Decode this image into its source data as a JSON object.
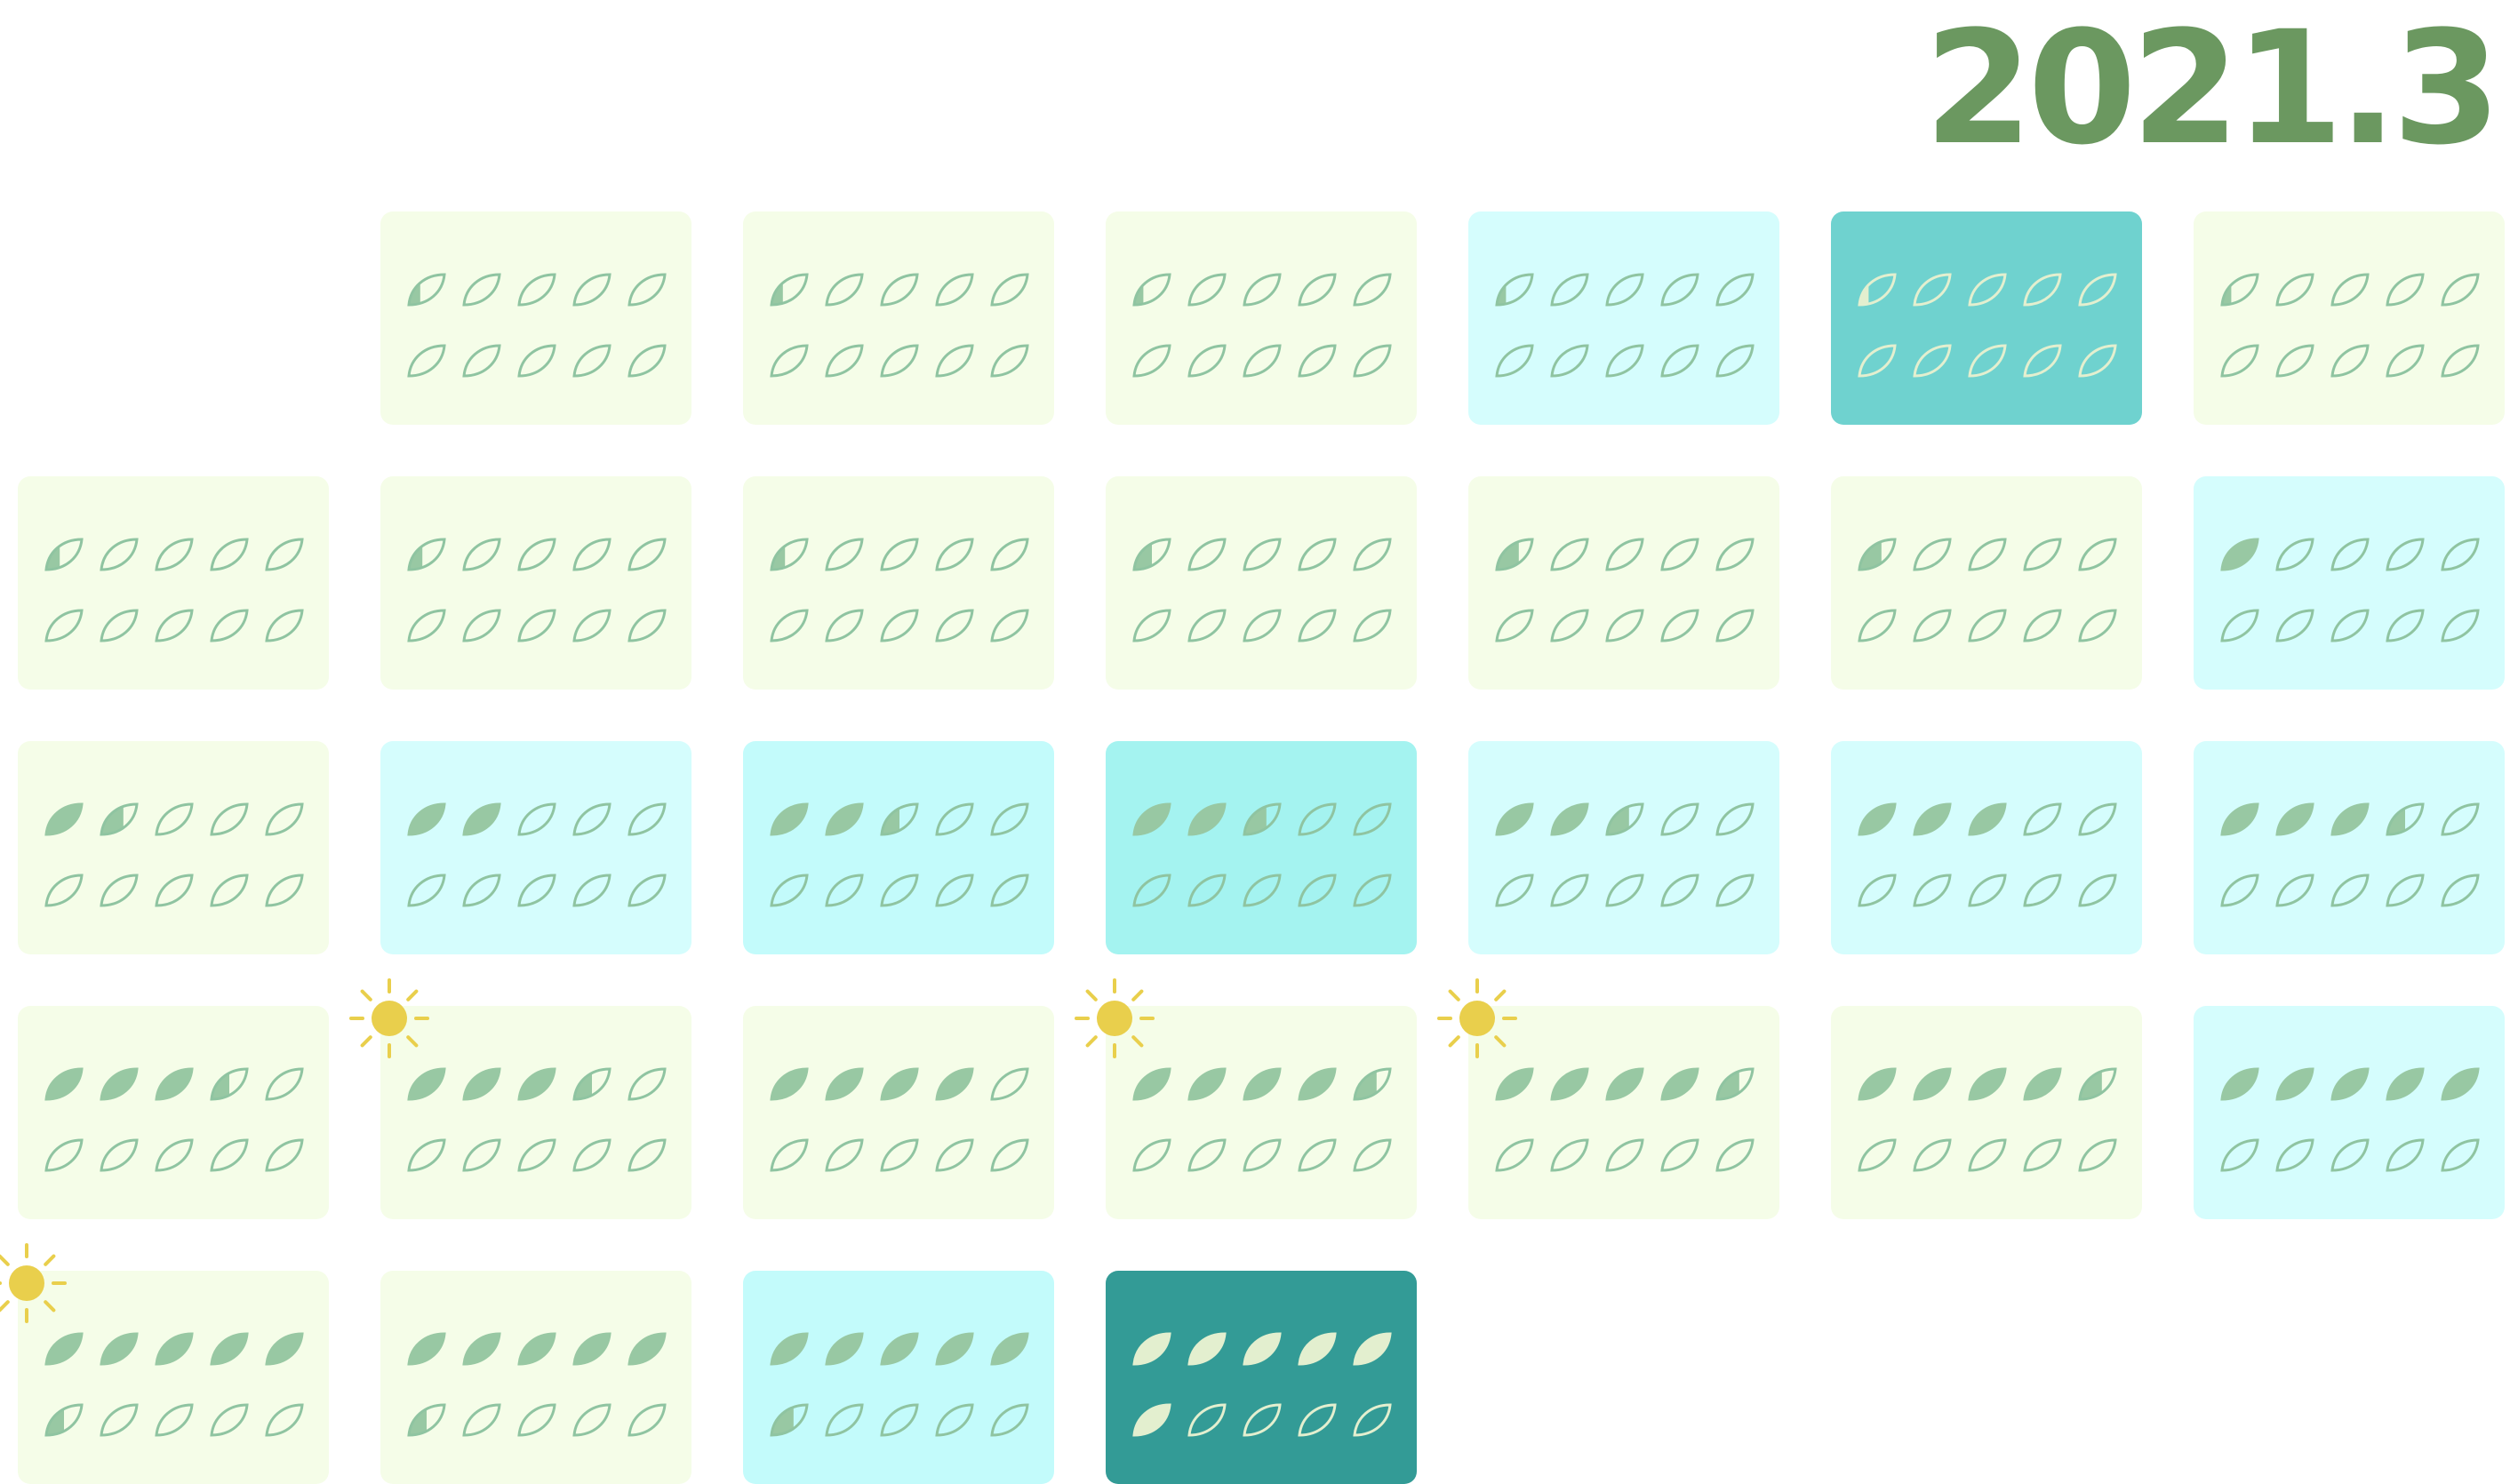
{
  "header": {
    "title": "2021.3"
  },
  "leaf_slots_per_day": 10,
  "colors": {
    "leaf_fill": "#98c8a3",
    "leaf_outline": "#8fc4a1",
    "leaf_fill_on_dark": "#e3efcf",
    "leaf_outline_on_dark": "#e3efcf",
    "sun": "#e9cf4c",
    "title": "#6b9860",
    "background": {
      "pale_green": "#f5fde8",
      "pale_cyan": "#d5fdfd",
      "light_cyan": "#c3fbfb",
      "cyan": "#a4f3f0",
      "teal": "#6fd2cf",
      "dark_teal": "#339b96"
    }
  },
  "days": [
    {
      "level": 0.35,
      "bg": "pale_green",
      "sun": false
    },
    {
      "level": 0.35,
      "bg": "pale_green",
      "sun": false
    },
    {
      "level": 0.3,
      "bg": "pale_green",
      "sun": false
    },
    {
      "level": 0.3,
      "bg": "pale_cyan",
      "sun": false
    },
    {
      "level": 0.3,
      "bg": "teal",
      "sun": false
    },
    {
      "level": 0.3,
      "bg": "pale_green",
      "sun": false
    },
    {
      "level": 0.4,
      "bg": "pale_green",
      "sun": false
    },
    {
      "level": 0.4,
      "bg": "pale_green",
      "sun": false
    },
    {
      "level": 0.4,
      "bg": "pale_green",
      "sun": false
    },
    {
      "level": 0.5,
      "bg": "pale_green",
      "sun": false
    },
    {
      "level": 0.6,
      "bg": "pale_green",
      "sun": false
    },
    {
      "level": 0.6,
      "bg": "pale_green",
      "sun": false
    },
    {
      "level": 1.0,
      "bg": "pale_cyan",
      "sun": false
    },
    {
      "level": 1.6,
      "bg": "pale_green",
      "sun": false
    },
    {
      "level": 2.0,
      "bg": "pale_cyan",
      "sun": false
    },
    {
      "level": 2.5,
      "bg": "light_cyan",
      "sun": false
    },
    {
      "level": 2.6,
      "bg": "cyan",
      "sun": false
    },
    {
      "level": 2.6,
      "bg": "pale_cyan",
      "sun": false
    },
    {
      "level": 3.0,
      "bg": "pale_cyan",
      "sun": false
    },
    {
      "level": 3.5,
      "bg": "pale_cyan",
      "sun": false
    },
    {
      "level": 3.5,
      "bg": "pale_green",
      "sun": false
    },
    {
      "level": 3.5,
      "bg": "pale_green",
      "sun": true
    },
    {
      "level": 4.0,
      "bg": "pale_green",
      "sun": false
    },
    {
      "level": 4.6,
      "bg": "pale_green",
      "sun": true
    },
    {
      "level": 4.6,
      "bg": "pale_green",
      "sun": true
    },
    {
      "level": 4.6,
      "bg": "pale_green",
      "sun": false
    },
    {
      "level": 5.0,
      "bg": "pale_cyan",
      "sun": false
    },
    {
      "level": 5.5,
      "bg": "pale_green",
      "sun": true
    },
    {
      "level": 5.5,
      "bg": "pale_green",
      "sun": false
    },
    {
      "level": 5.6,
      "bg": "light_cyan",
      "sun": false
    },
    {
      "level": 6.0,
      "bg": "dark_teal",
      "sun": false
    }
  ]
}
